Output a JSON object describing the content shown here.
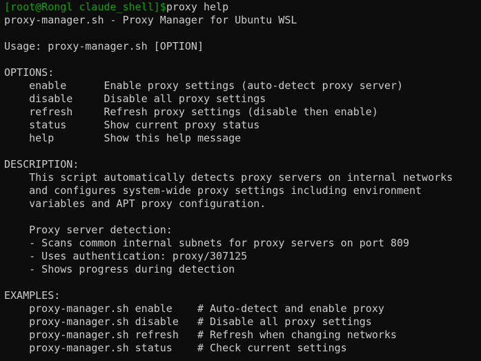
{
  "prompt": {
    "text": "[root@Rongl claude_shell]$",
    "command": "proxy help"
  },
  "output_lines": [
    "proxy-manager.sh - Proxy Manager for Ubuntu WSL",
    "",
    "Usage: proxy-manager.sh [OPTION]",
    "",
    "OPTIONS:",
    "    enable      Enable proxy settings (auto-detect proxy server)",
    "    disable     Disable all proxy settings",
    "    refresh     Refresh proxy settings (disable then enable)",
    "    status      Show current proxy status",
    "    help        Show this help message",
    "",
    "DESCRIPTION:",
    "    This script automatically detects proxy servers on internal networks",
    "    and configures system-wide proxy settings including environment",
    "    variables and APT proxy configuration.",
    "",
    "    Proxy server detection:",
    "    - Scans common internal subnets for proxy servers on port 809",
    "    - Uses authentication: proxy/307125",
    "    - Shows progress during detection",
    "",
    "EXAMPLES:",
    "    proxy-manager.sh enable    # Auto-detect and enable proxy",
    "    proxy-manager.sh disable   # Disable all proxy settings",
    "    proxy-manager.sh refresh   # Refresh when changing networks",
    "    proxy-manager.sh status    # Check current settings"
  ],
  "colors": {
    "background": "#0c0c0c",
    "foreground": "#cccccc",
    "prompt": "#13a10e"
  }
}
